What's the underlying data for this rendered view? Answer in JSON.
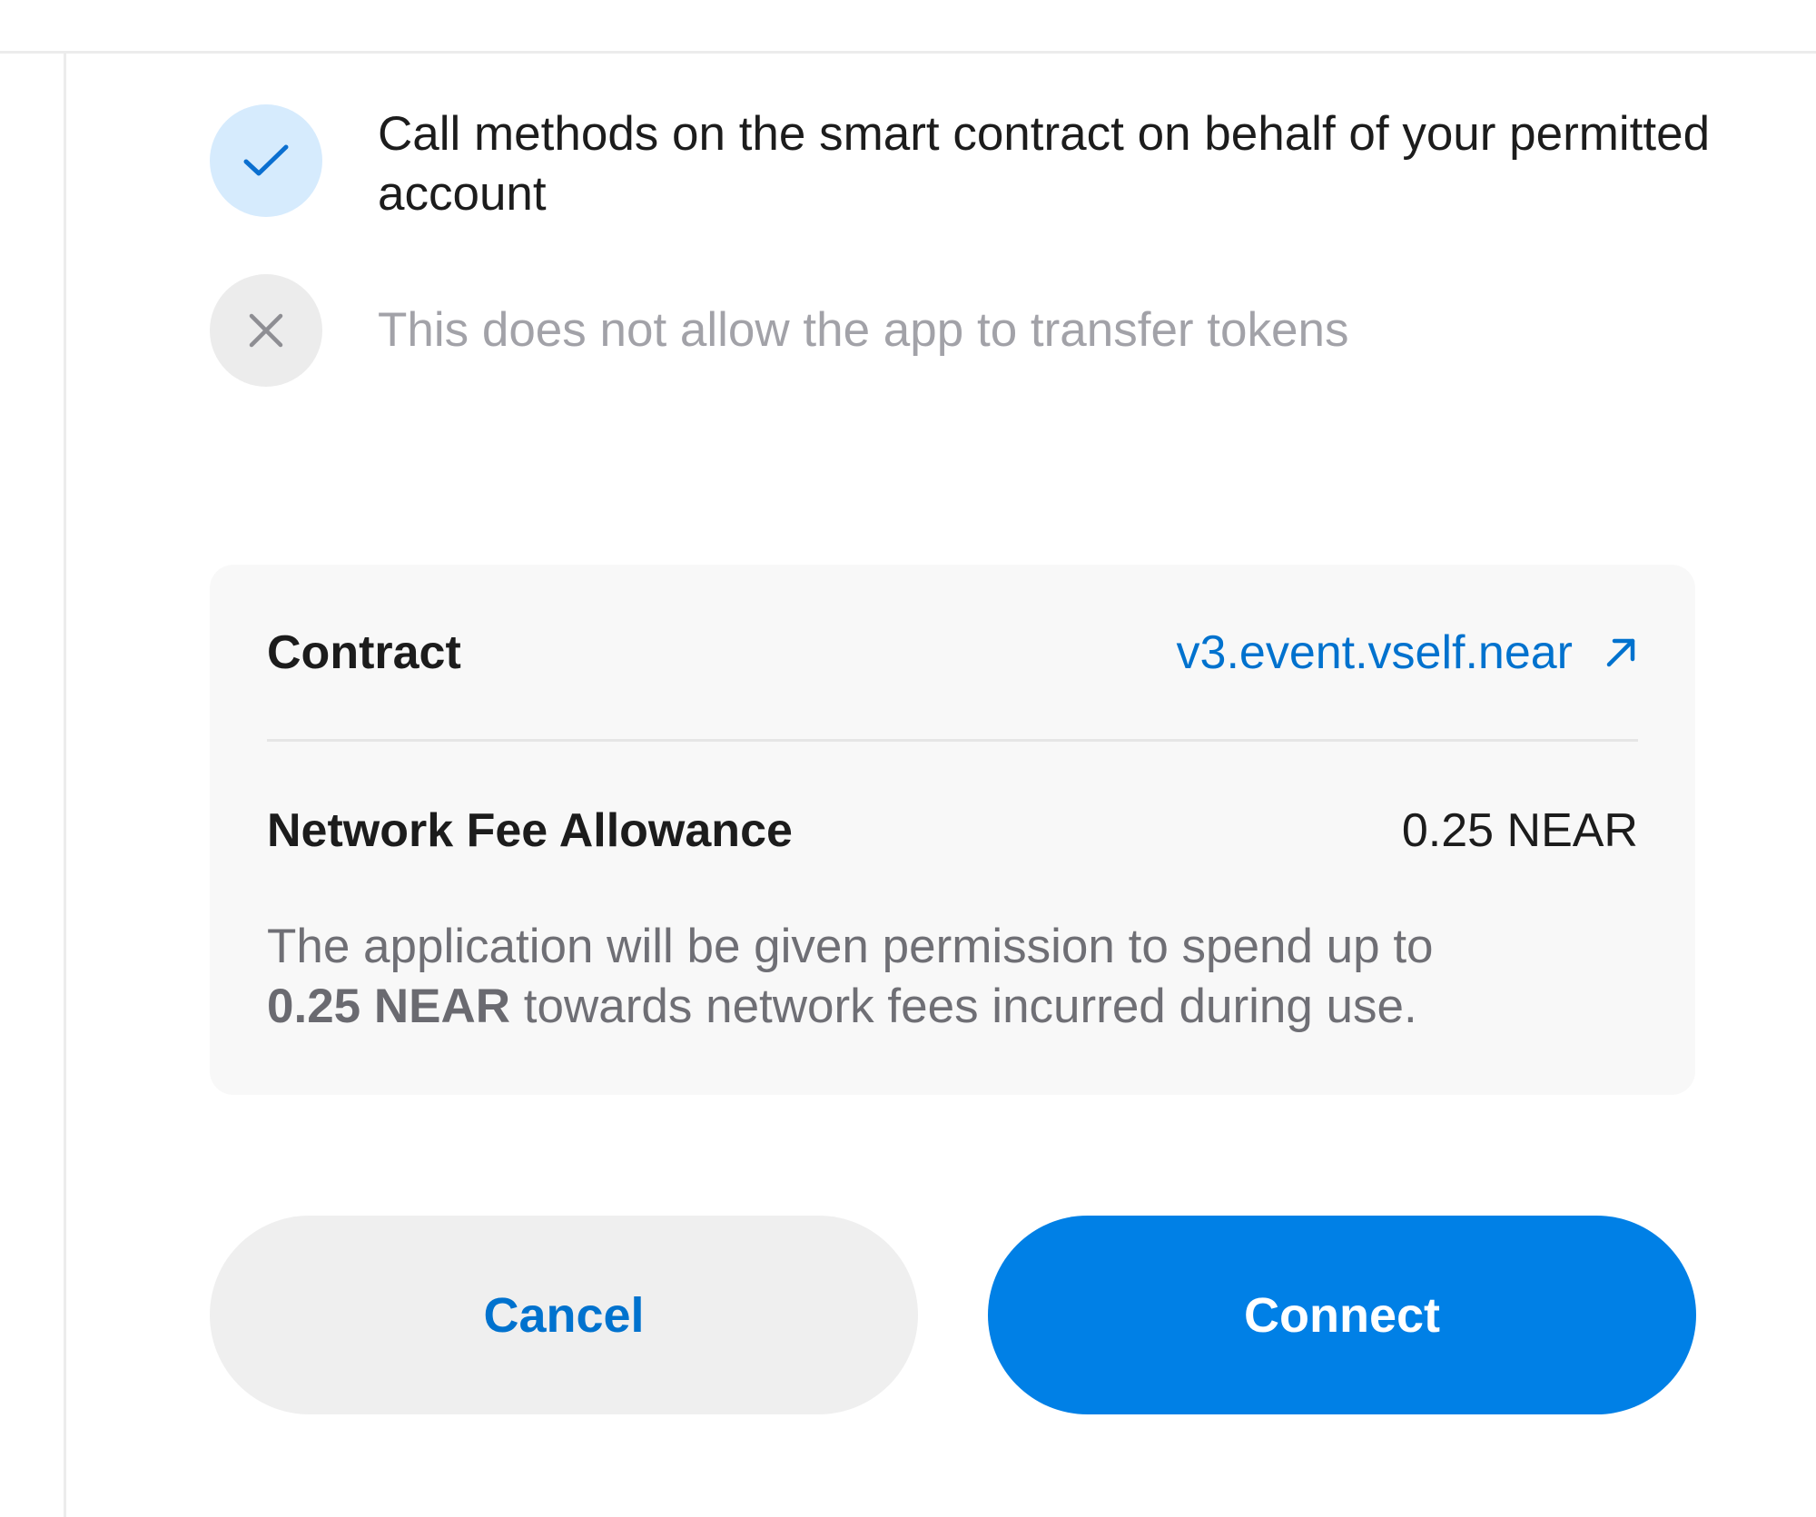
{
  "permissions": [
    {
      "icon": "check-icon",
      "allowed": true,
      "text": "Call methods on the smart contract on behalf of your permitted account"
    },
    {
      "icon": "close-icon",
      "allowed": false,
      "text": "This does not allow the app to transfer tokens"
    }
  ],
  "details": {
    "contract_label": "Contract",
    "contract_value": "v3.event.vself.near",
    "contract_link_icon": "external-link-arrow-icon",
    "fee_label": "Network Fee Allowance",
    "fee_value": "0.25 NEAR",
    "fee_description_prefix": "The application will be given permission to spend up to",
    "fee_description_amount": "0.25 NEAR",
    "fee_description_suffix": "towards network fees incurred during use."
  },
  "actions": {
    "cancel_label": "Cancel",
    "connect_label": "Connect"
  },
  "colors": {
    "accent": "#0080e6",
    "link": "#0072ce",
    "check_bg": "#d6ebfd",
    "deny_bg": "#ececec",
    "card_bg": "#f8f8f8"
  }
}
